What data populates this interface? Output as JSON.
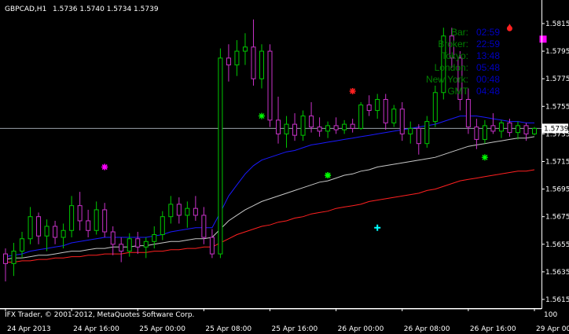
{
  "header": {
    "symbol": "GBPCAD,H1",
    "ohlc": "1.5736 1.5740 1.5734 1.5739"
  },
  "footer": {
    "copyright": "IFX Trader, © 2001-2012, MetaQuotes Software Corp."
  },
  "clock_panel": {
    "rows": [
      {
        "label": "Bar:",
        "value": "02:59"
      },
      {
        "label": "Broker:",
        "value": "22:59"
      },
      {
        "label": "Tokyo:",
        "value": "13:48"
      },
      {
        "label": "London:",
        "value": "05:48"
      },
      {
        "label": "New York:",
        "value": "00:48"
      },
      {
        "label": "GMT",
        "value": "04:48"
      }
    ]
  },
  "colors": {
    "background": "#000000",
    "axis": "#ffffff",
    "bull_candle": "#00c800",
    "bear_candle": "#c832c8",
    "ma_blue": "#1a1aff",
    "ma_gray": "#c8c8c8",
    "ma_red": "#ff2020",
    "clock_label": "#008000",
    "clock_value": "#0000c0",
    "current_price_line": "#9aa0aa"
  },
  "markers": [
    {
      "kind": "magenta-star",
      "x": 12,
      "y": 1.5711,
      "color": "#ff00ff"
    },
    {
      "kind": "green-cross-star",
      "x": 31,
      "y": 1.5748,
      "color": "#00ff00"
    },
    {
      "kind": "red-star",
      "x": 42,
      "y": 1.5766,
      "color": "#ff2020"
    },
    {
      "kind": "green-star",
      "x": 39,
      "y": 1.5705,
      "color": "#00ff00"
    },
    {
      "kind": "cyan-cross",
      "x": 45,
      "y": 1.5667,
      "color": "#00ffff"
    },
    {
      "kind": "red-drop",
      "x": 61,
      "y": 1.5812,
      "color": "#ff2020"
    },
    {
      "kind": "magenta-square",
      "x": 65,
      "y": 1.5804,
      "color": "#ff00ff"
    },
    {
      "kind": "green-cross-star-2",
      "x": 58,
      "y": 1.5718,
      "color": "#00ff00"
    }
  ],
  "chart_data": {
    "type": "candlestick",
    "symbol": "GBPCAD",
    "timeframe": "H1",
    "ylim": [
      1.561,
      1.5825
    ],
    "y_ticks": [
      1.5615,
      1.5635,
      1.5655,
      1.5675,
      1.5695,
      1.5715,
      1.5735,
      1.5755,
      1.5775,
      1.5795,
      1.5815
    ],
    "x_ticks": [
      {
        "bar": 0,
        "label": "24 Apr 2013"
      },
      {
        "bar": 8,
        "label": "24 Apr 16:00"
      },
      {
        "bar": 16,
        "label": "25 Apr 00:00"
      },
      {
        "bar": 24,
        "label": "25 Apr 08:00"
      },
      {
        "bar": 32,
        "label": "25 Apr 16:00"
      },
      {
        "bar": 40,
        "label": "26 Apr 00:00"
      },
      {
        "bar": 48,
        "label": "26 Apr 08:00"
      },
      {
        "bar": 56,
        "label": "26 Apr 16:00"
      },
      {
        "bar": 64,
        "label": "29 Apr 00:00"
      }
    ],
    "current_price": 1.5739,
    "current_price_label": "1.5739",
    "candles": [
      [
        1.5648,
        1.5652,
        1.5628,
        1.5641
      ],
      [
        1.5641,
        1.5656,
        1.5632,
        1.565
      ],
      [
        1.565,
        1.5664,
        1.5645,
        1.5659
      ],
      [
        1.5659,
        1.5682,
        1.5655,
        1.5675
      ],
      [
        1.5675,
        1.5678,
        1.5655,
        1.5661
      ],
      [
        1.5661,
        1.5673,
        1.565,
        1.5668
      ],
      [
        1.5668,
        1.5672,
        1.5655,
        1.566
      ],
      [
        1.566,
        1.567,
        1.5652,
        1.5665
      ],
      [
        1.5665,
        1.569,
        1.566,
        1.5683
      ],
      [
        1.5683,
        1.5693,
        1.5665,
        1.5672
      ],
      [
        1.5672,
        1.568,
        1.566,
        1.5665
      ],
      [
        1.5665,
        1.5686,
        1.5662,
        1.568
      ],
      [
        1.568,
        1.5685,
        1.566,
        1.5664
      ],
      [
        1.5664,
        1.5668,
        1.5647,
        1.5655
      ],
      [
        1.5655,
        1.566,
        1.5642,
        1.565
      ],
      [
        1.565,
        1.5663,
        1.5646,
        1.5659
      ],
      [
        1.5659,
        1.5664,
        1.5648,
        1.5653
      ],
      [
        1.5653,
        1.566,
        1.5645,
        1.5657
      ],
      [
        1.5657,
        1.5668,
        1.5652,
        1.5662
      ],
      [
        1.5662,
        1.5679,
        1.5658,
        1.5675
      ],
      [
        1.5675,
        1.569,
        1.567,
        1.5684
      ],
      [
        1.5684,
        1.5689,
        1.567,
        1.5676
      ],
      [
        1.5676,
        1.5686,
        1.5667,
        1.5681
      ],
      [
        1.5681,
        1.569,
        1.5672,
        1.5676
      ],
      [
        1.5676,
        1.5682,
        1.5655,
        1.566
      ],
      [
        1.566,
        1.5666,
        1.5645,
        1.5648
      ],
      [
        1.5648,
        1.5797,
        1.5645,
        1.579
      ],
      [
        1.579,
        1.58,
        1.5773,
        1.5785
      ],
      [
        1.5785,
        1.5803,
        1.5777,
        1.5795
      ],
      [
        1.5795,
        1.5808,
        1.5785,
        1.5798
      ],
      [
        1.5798,
        1.5818,
        1.577,
        1.5775
      ],
      [
        1.5775,
        1.58,
        1.5768,
        1.5795
      ],
      [
        1.5795,
        1.58,
        1.574,
        1.5745
      ],
      [
        1.5745,
        1.5762,
        1.5728,
        1.5735
      ],
      [
        1.5735,
        1.5748,
        1.5725,
        1.5742
      ],
      [
        1.5742,
        1.575,
        1.573,
        1.5734
      ],
      [
        1.5734,
        1.5752,
        1.573,
        1.5748
      ],
      [
        1.5748,
        1.5758,
        1.5736,
        1.574
      ],
      [
        1.574,
        1.5747,
        1.5733,
        1.5737
      ],
      [
        1.5737,
        1.5744,
        1.5732,
        1.5741
      ],
      [
        1.5741,
        1.5747,
        1.5735,
        1.5738
      ],
      [
        1.5738,
        1.5745,
        1.5735,
        1.5742
      ],
      [
        1.5742,
        1.5746,
        1.5736,
        1.5739
      ],
      [
        1.5739,
        1.5758,
        1.5738,
        1.5756
      ],
      [
        1.5756,
        1.5763,
        1.5748,
        1.5752
      ],
      [
        1.5752,
        1.5764,
        1.5746,
        1.576
      ],
      [
        1.576,
        1.5764,
        1.5738,
        1.5743
      ],
      [
        1.5743,
        1.5756,
        1.574,
        1.5753
      ],
      [
        1.5753,
        1.5758,
        1.573,
        1.5735
      ],
      [
        1.5735,
        1.5744,
        1.5728,
        1.5739
      ],
      [
        1.5739,
        1.5742,
        1.572,
        1.5728
      ],
      [
        1.5728,
        1.5748,
        1.5725,
        1.5744
      ],
      [
        1.5744,
        1.577,
        1.574,
        1.5765
      ],
      [
        1.5765,
        1.5812,
        1.576,
        1.5806
      ],
      [
        1.5806,
        1.5812,
        1.5783,
        1.579
      ],
      [
        1.579,
        1.5795,
        1.5752,
        1.576
      ],
      [
        1.576,
        1.5768,
        1.5735,
        1.574
      ],
      [
        1.574,
        1.5746,
        1.5724,
        1.5731
      ],
      [
        1.5731,
        1.5745,
        1.5728,
        1.5741
      ],
      [
        1.5741,
        1.575,
        1.5735,
        1.5737
      ],
      [
        1.5737,
        1.5745,
        1.5732,
        1.5743
      ],
      [
        1.5743,
        1.5746,
        1.5733,
        1.5736
      ],
      [
        1.5736,
        1.5744,
        1.5731,
        1.5741
      ],
      [
        1.5741,
        1.5743,
        1.573,
        1.5735
      ],
      [
        1.5735,
        1.574,
        1.5734,
        1.5739
      ]
    ],
    "ma_blue": [
      1.5646,
      1.5647,
      1.5648,
      1.565,
      1.5651,
      1.5652,
      1.5653,
      1.5654,
      1.5656,
      1.5657,
      1.5658,
      1.5659,
      1.566,
      1.566,
      1.566,
      1.566,
      1.566,
      1.566,
      1.5661,
      1.5662,
      1.5664,
      1.5665,
      1.5666,
      1.5667,
      1.5667,
      1.5667,
      1.5678,
      1.569,
      1.5698,
      1.5706,
      1.5712,
      1.5716,
      1.5718,
      1.572,
      1.5722,
      1.5723,
      1.5725,
      1.5727,
      1.5728,
      1.5729,
      1.573,
      1.5731,
      1.5732,
      1.5733,
      1.5734,
      1.5735,
      1.5736,
      1.5737,
      1.5738,
      1.5739,
      1.574,
      1.5741,
      1.5742,
      1.5744,
      1.5746,
      1.5748,
      1.5748,
      1.5748,
      1.5747,
      1.5746,
      1.5745,
      1.5744,
      1.5744,
      1.5743,
      1.5743
    ],
    "ma_gray": [
      1.5644,
      1.5645,
      1.5645,
      1.5646,
      1.5647,
      1.5647,
      1.5648,
      1.5649,
      1.565,
      1.565,
      1.5651,
      1.5652,
      1.5652,
      1.5653,
      1.5653,
      1.5653,
      1.5654,
      1.5654,
      1.5655,
      1.5656,
      1.5657,
      1.5657,
      1.5658,
      1.5659,
      1.5659,
      1.566,
      1.5666,
      1.5672,
      1.5676,
      1.568,
      1.5683,
      1.5686,
      1.5688,
      1.569,
      1.5692,
      1.5694,
      1.5696,
      1.5698,
      1.57,
      1.5701,
      1.5703,
      1.5705,
      1.5706,
      1.5708,
      1.5709,
      1.5711,
      1.5712,
      1.5713,
      1.5714,
      1.5715,
      1.5716,
      1.5717,
      1.5718,
      1.572,
      1.5722,
      1.5724,
      1.5726,
      1.5727,
      1.5728,
      1.5729,
      1.573,
      1.5731,
      1.5732,
      1.5732,
      1.5733
    ],
    "ma_red": [
      1.5642,
      1.5642,
      1.5643,
      1.5643,
      1.5644,
      1.5644,
      1.5645,
      1.5645,
      1.5646,
      1.5646,
      1.5647,
      1.5647,
      1.5648,
      1.5648,
      1.5648,
      1.5649,
      1.5649,
      1.5649,
      1.565,
      1.565,
      1.5651,
      1.5651,
      1.5652,
      1.5652,
      1.5653,
      1.5653,
      1.5656,
      1.5659,
      1.5662,
      1.5664,
      1.5666,
      1.5668,
      1.5669,
      1.5671,
      1.5672,
      1.5674,
      1.5675,
      1.5677,
      1.5678,
      1.5679,
      1.5681,
      1.5682,
      1.5683,
      1.5684,
      1.5686,
      1.5687,
      1.5688,
      1.5689,
      1.569,
      1.5691,
      1.5692,
      1.5694,
      1.5695,
      1.5697,
      1.5699,
      1.5701,
      1.5702,
      1.5703,
      1.5704,
      1.5705,
      1.5706,
      1.5707,
      1.5708,
      1.5708,
      1.5709
    ]
  }
}
